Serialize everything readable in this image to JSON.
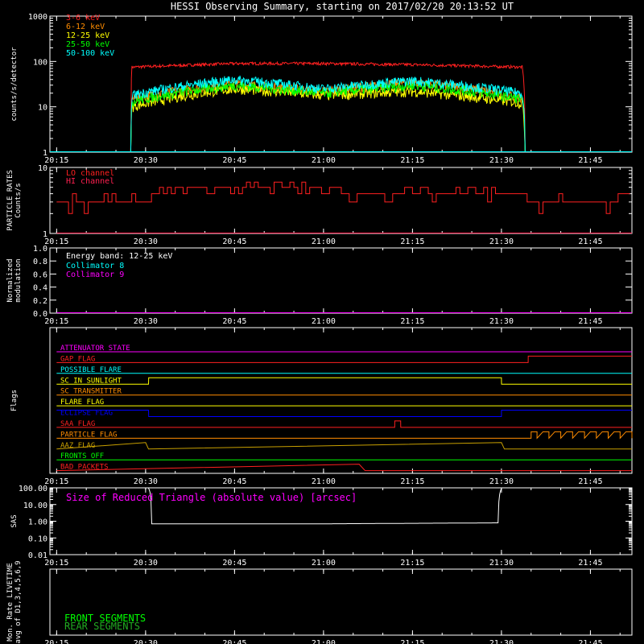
{
  "title": "HESSI Observing Summary, starting on 2017/02/20 20:13:52 UT",
  "time_ticks": [
    "20:15",
    "20:30",
    "20:45",
    "21:00",
    "21:15",
    "21:30",
    "21:45"
  ],
  "chart_data": [
    {
      "type": "line",
      "panel": "count_rates",
      "ylabel": "counts/s/detector",
      "yscale": "log",
      "ylim": [
        1,
        1000
      ],
      "ytick_labels": [
        "1",
        "10",
        "100",
        "1000"
      ],
      "xlim": [
        "20:13:52",
        "21:52:00"
      ],
      "series": [
        {
          "name": "3-6 keV",
          "color": "#ff2020",
          "x": [
            "20:27:30",
            "20:27:40",
            "20:45",
            "21:00",
            "21:15",
            "21:33:30",
            "21:34:00"
          ],
          "y": [
            1,
            75,
            90,
            90,
            85,
            75,
            1
          ]
        },
        {
          "name": "6-12 keV",
          "color": "#ff8c00",
          "x": [
            "20:27:30",
            "20:27:40",
            "20:45",
            "21:00",
            "21:15",
            "21:33:30",
            "21:34:00"
          ],
          "y": [
            1,
            15,
            32,
            22,
            35,
            16,
            1
          ]
        },
        {
          "name": "12-25 keV",
          "color": "#ffff00",
          "x": [
            "20:27:30",
            "20:27:40",
            "20:45",
            "21:00",
            "21:15",
            "21:33:30",
            "21:34:00"
          ],
          "y": [
            1,
            10,
            25,
            18,
            22,
            12,
            1
          ]
        },
        {
          "name": "25-50 keV",
          "color": "#00ff00",
          "x": [
            "20:27:30",
            "20:27:40",
            "20:45",
            "21:00",
            "21:15",
            "21:33:30",
            "21:34:00"
          ],
          "y": [
            1,
            13,
            30,
            20,
            30,
            15,
            1
          ]
        },
        {
          "name": "50-100 keV",
          "color": "#00ffff",
          "x": [
            "20:27:30",
            "20:27:40",
            "20:45",
            "21:00",
            "21:15",
            "21:33:30",
            "21:34:00"
          ],
          "y": [
            1,
            18,
            40,
            25,
            38,
            20,
            1
          ]
        }
      ]
    },
    {
      "type": "line",
      "panel": "particle_rates",
      "ylabel": "PARTICLE RATES Counts/s",
      "yscale": "log",
      "ylim": [
        1,
        10
      ],
      "ytick_labels": [
        "1",
        "10"
      ],
      "series": [
        {
          "name": "LO channel",
          "color": "#ff2020",
          "x": [
            "20:15",
            "20:29",
            "20:32",
            "20:45",
            "20:55",
            "21:05",
            "21:15",
            "21:30",
            "21:37",
            "21:52"
          ],
          "y": [
            3,
            3,
            4,
            5,
            5,
            4,
            4,
            4,
            3,
            3
          ]
        },
        {
          "name": "HI channel",
          "color": "#ff2050",
          "x": [
            "20:15",
            "21:52"
          ],
          "y": [
            1,
            1
          ]
        }
      ]
    },
    {
      "type": "line",
      "panel": "modulation",
      "ylabel": "Normalized modulation",
      "ylim": [
        0,
        1
      ],
      "ytick_labels": [
        "0.0",
        "0.2",
        "0.4",
        "0.6",
        "0.8",
        "1.0"
      ],
      "annotation": "Energy band: 12-25 keV",
      "series": [
        {
          "name": "Collimator 8",
          "color": "#00ffff",
          "x": [
            "20:15",
            "21:52"
          ],
          "y": [
            0,
            0
          ]
        },
        {
          "name": "Collimator 9",
          "color": "#ff00ff",
          "x": [
            "20:15",
            "21:52"
          ],
          "y": [
            0,
            0
          ]
        }
      ]
    },
    {
      "type": "line",
      "panel": "flags",
      "ylabel": "Flags",
      "series": [
        {
          "name": "ATTENUATOR STATE",
          "color": "#ff00ff",
          "x": [
            "20:15",
            "21:52"
          ],
          "y": [
            0,
            0
          ]
        },
        {
          "name": "GAP FLAG",
          "color": "#ff2020",
          "x": [
            "20:15",
            "21:34:30",
            "21:34:31",
            "21:52"
          ],
          "y": [
            0,
            0,
            1,
            1
          ]
        },
        {
          "name": "POSSIBLE FLARE",
          "color": "#00ffff",
          "x": [
            "20:15",
            "21:52"
          ],
          "y": [
            0,
            0
          ]
        },
        {
          "name": "SC IN SUNLIGHT",
          "color": "#ffff00",
          "x": [
            "20:15",
            "20:30:30",
            "20:30:31",
            "21:30:00",
            "21:30:01",
            "21:52"
          ],
          "y": [
            0,
            0,
            1,
            1,
            0,
            0
          ]
        },
        {
          "name": "SC TRANSMITTER",
          "color": "#ff8c00",
          "x": [
            "20:15",
            "21:52"
          ],
          "y": [
            0,
            0
          ]
        },
        {
          "name": "FLARE FLAG",
          "color": "#ffff00",
          "x": [
            "20:15",
            "21:52"
          ],
          "y": [
            0,
            0
          ]
        },
        {
          "name": "ECLIPSE FLAG",
          "color": "#0000ff",
          "x": [
            "20:15",
            "20:30:30",
            "20:30:31",
            "21:30:00",
            "21:30:01",
            "21:52"
          ],
          "y": [
            1,
            1,
            0,
            0,
            1,
            1
          ]
        },
        {
          "name": "SAA FLAG",
          "color": "#ff2020",
          "x": [
            "20:15",
            "21:12",
            "21:12:01",
            "21:13",
            "21:13:01",
            "21:52"
          ],
          "y": [
            0,
            0,
            1,
            1,
            0,
            0
          ]
        },
        {
          "name": "PARTICLE FLAG",
          "color": "#ff8c00",
          "x": [
            "20:15",
            "21:35",
            "21:52"
          ],
          "y": [
            0,
            0,
            1
          ]
        },
        {
          "name": "AAZ FLAG",
          "color": "#c8a000",
          "x": [
            "20:15",
            "20:30:00",
            "20:30:30",
            "21:30:00",
            "21:30:30",
            "21:52"
          ],
          "y": [
            0,
            1,
            0,
            1,
            0,
            0
          ]
        },
        {
          "name": "FRONTS OFF",
          "color": "#00ff00",
          "x": [
            "20:15",
            "21:52"
          ],
          "y": [
            0,
            0
          ]
        },
        {
          "name": "BAD PACKETS",
          "color": "#ff2020",
          "x": [
            "20:15",
            "21:06",
            "21:07",
            "21:52"
          ],
          "y": [
            0,
            1,
            0,
            0
          ]
        }
      ]
    },
    {
      "type": "line",
      "panel": "sas",
      "ylabel": "SAS",
      "yscale": "log",
      "ylim": [
        0.01,
        100
      ],
      "ytick_labels": [
        "0.01",
        "0.10",
        "1.00",
        "10.00",
        "100.00"
      ],
      "annotation": "Size of Reduced Triangle (absolute value) [arcsec]",
      "series": [
        {
          "name": "",
          "color": "#ffffff",
          "x": [
            "20:30:30",
            "20:31",
            "20:45",
            "21:00",
            "21:15",
            "21:29:30",
            "21:30:00"
          ],
          "y": [
            100,
            0.7,
            0.7,
            0.7,
            0.75,
            0.8,
            100
          ]
        }
      ]
    },
    {
      "type": "line",
      "panel": "livetime",
      "ylabel": "Mon. Rate LIVETIME avg of D1,3,4,5,6,9",
      "series": [
        {
          "name": "FRONT SEGMENTS",
          "color": "#00ff00",
          "x": [],
          "y": []
        },
        {
          "name": "REAR SEGMENTS",
          "color": "#22aa22",
          "x": [],
          "y": []
        }
      ]
    }
  ]
}
